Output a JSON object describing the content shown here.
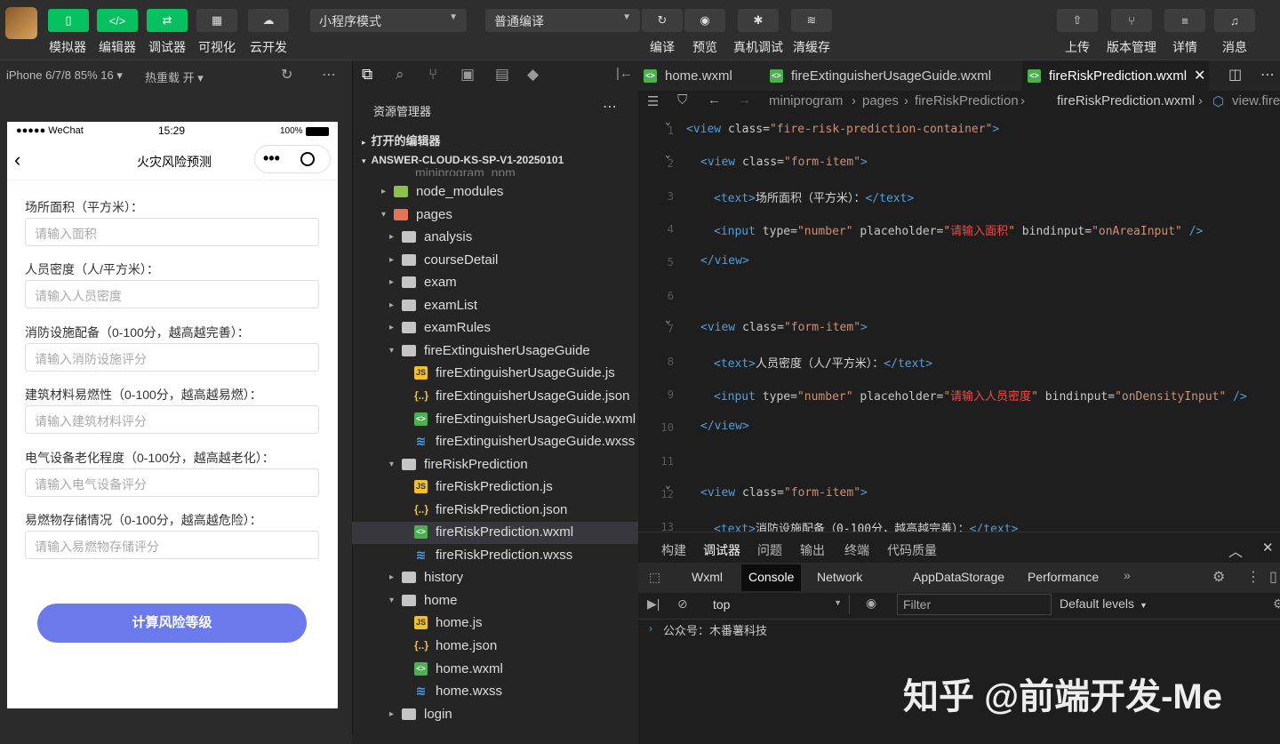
{
  "toolbar": {
    "left_buttons": [
      {
        "label": "模拟器",
        "icon": "phone-icon",
        "symbol": "▯",
        "green": true
      },
      {
        "label": "编辑器",
        "icon": "code-icon",
        "symbol": "</>",
        "green": true
      },
      {
        "label": "调试器",
        "icon": "debug-icon",
        "symbol": "⇄",
        "green": true
      },
      {
        "label": "可视化",
        "icon": "layout-icon",
        "symbol": "▦",
        "green": false
      },
      {
        "label": "云开发",
        "icon": "cloud-icon",
        "symbol": "☁",
        "green": false
      }
    ],
    "mode_select": "小程序模式",
    "compile_select": "普通编译",
    "mid_buttons": [
      {
        "label": "编译",
        "icon": "refresh-icon",
        "symbol": "↻"
      },
      {
        "label": "预览",
        "icon": "eye-icon",
        "symbol": "◉"
      },
      {
        "label": "真机调试",
        "icon": "bug-icon",
        "symbol": "✱"
      },
      {
        "label": "清缓存",
        "icon": "layers-icon",
        "symbol": "≋"
      }
    ],
    "right_buttons": [
      {
        "label": "上传",
        "icon": "upload-icon",
        "symbol": "⇧"
      },
      {
        "label": "版本管理",
        "icon": "branch-icon",
        "symbol": "⑂"
      },
      {
        "label": "详情",
        "icon": "menu-icon",
        "symbol": "≡"
      },
      {
        "label": "消息",
        "icon": "bell-icon",
        "symbol": "♫"
      }
    ]
  },
  "simulator": {
    "device": "iPhone 6/7/8 85% 16 ▾",
    "hot_reload": "热重载 开 ▾",
    "status_carrier": "●●●●● WeChat",
    "status_time": "15:29",
    "status_battery": "100%",
    "nav_title": "火灾风险预测",
    "fields": [
      {
        "label": "场所面积（平方米）：",
        "placeholder": "请输入面积"
      },
      {
        "label": "人员密度（人/平方米）：",
        "placeholder": "请输入人员密度"
      },
      {
        "label": "消防设施配备（0-100分，越高越完善）：",
        "placeholder": "请输入消防设施评分"
      },
      {
        "label": "建筑材料易燃性（0-100分，越高越易燃）：",
        "placeholder": "请输入建筑材料评分"
      },
      {
        "label": "电气设备老化程度（0-100分，越高越老化）：",
        "placeholder": "请输入电气设备评分"
      },
      {
        "label": "易燃物存储情况（0-100分，越高越危险）：",
        "placeholder": "请输入易燃物存储评分"
      }
    ],
    "submit_label": "计算风险等级"
  },
  "explorer": {
    "title": "资源管理器",
    "open_editors": "打开的编辑器",
    "project": "ANSWER-CLOUD-KS-SP-V1-20250101",
    "partial_top": "miniprogram_npm",
    "items": [
      {
        "label": "node_modules",
        "type": "folder-green",
        "depth": 1,
        "arrow": "▸"
      },
      {
        "label": "pages",
        "type": "folder-red",
        "depth": 1,
        "arrow": "▾"
      },
      {
        "label": "analysis",
        "type": "folder",
        "depth": 2,
        "arrow": "▸"
      },
      {
        "label": "courseDetail",
        "type": "folder",
        "depth": 2,
        "arrow": "▸"
      },
      {
        "label": "exam",
        "type": "folder",
        "depth": 2,
        "arrow": "▸"
      },
      {
        "label": "examList",
        "type": "folder",
        "depth": 2,
        "arrow": "▸"
      },
      {
        "label": "examRules",
        "type": "folder",
        "depth": 2,
        "arrow": "▸"
      },
      {
        "label": "fireExtinguisherUsageGuide",
        "type": "folder",
        "depth": 2,
        "arrow": "▾"
      },
      {
        "label": "fireExtinguisherUsageGuide.js",
        "type": "js",
        "depth": 3,
        "arrow": ""
      },
      {
        "label": "fireExtinguisherUsageGuide.json",
        "type": "json",
        "depth": 3,
        "arrow": ""
      },
      {
        "label": "fireExtinguisherUsageGuide.wxml",
        "type": "wxml",
        "depth": 3,
        "arrow": ""
      },
      {
        "label": "fireExtinguisherUsageGuide.wxss",
        "type": "wxss",
        "depth": 3,
        "arrow": ""
      },
      {
        "label": "fireRiskPrediction",
        "type": "folder",
        "depth": 2,
        "arrow": "▾"
      },
      {
        "label": "fireRiskPrediction.js",
        "type": "js",
        "depth": 3,
        "arrow": ""
      },
      {
        "label": "fireRiskPrediction.json",
        "type": "json",
        "depth": 3,
        "arrow": ""
      },
      {
        "label": "fireRiskPrediction.wxml",
        "type": "wxml",
        "depth": 3,
        "arrow": "",
        "selected": true
      },
      {
        "label": "fireRiskPrediction.wxss",
        "type": "wxss",
        "depth": 3,
        "arrow": ""
      },
      {
        "label": "history",
        "type": "folder",
        "depth": 2,
        "arrow": "▸"
      },
      {
        "label": "home",
        "type": "folder",
        "depth": 2,
        "arrow": "▾"
      },
      {
        "label": "home.js",
        "type": "js",
        "depth": 3,
        "arrow": ""
      },
      {
        "label": "home.json",
        "type": "json",
        "depth": 3,
        "arrow": ""
      },
      {
        "label": "home.wxml",
        "type": "wxml",
        "depth": 3,
        "arrow": ""
      },
      {
        "label": "home.wxss",
        "type": "wxss",
        "depth": 3,
        "arrow": ""
      },
      {
        "label": "login",
        "type": "folder",
        "depth": 2,
        "arrow": "▸"
      }
    ]
  },
  "editor": {
    "tabs": [
      {
        "label": "home.wxml",
        "active": false
      },
      {
        "label": "fireExtinguisherUsageGuide.wxml",
        "active": false
      },
      {
        "label": "fireRiskPrediction.wxml",
        "active": true
      }
    ],
    "breadcrumb": [
      "miniprogram",
      "pages",
      "fireRiskPrediction",
      "fireRiskPrediction.wxml",
      "view.fire"
    ],
    "line_numbers": [
      "1",
      "2",
      "3",
      "4",
      "5",
      "6",
      "7",
      "8",
      "9",
      "10",
      "11",
      "12",
      "13"
    ],
    "code": {
      "l1": {
        "tag": "<view",
        "attr": " class=",
        "val": "\"fire-risk-prediction-container\"",
        "end": ">"
      },
      "l2": {
        "tag": "<view",
        "attr": " class=",
        "val": "\"form-item\"",
        "end": ">"
      },
      "l3": {
        "open": "<text>",
        "text": "场所面积（平方米）：",
        "close": "</text>"
      },
      "l4": {
        "tag": "<input",
        "a1": " type=",
        "v1": "\"number\"",
        "a2": " placeholder=",
        "v2q1": "\"",
        "v2": "请输入面积",
        "v2q2": "\"",
        "a3": " bindinput=",
        "v3": "\"onAreaInput\"",
        "end": " />"
      },
      "l5": {
        "close": "</view>"
      },
      "l7": {
        "tag": "<view",
        "attr": " class=",
        "val": "\"form-item\"",
        "end": ">"
      },
      "l8": {
        "open": "<text>",
        "text": "人员密度（人/平方米）：",
        "close": "</text>"
      },
      "l9": {
        "tag": "<input",
        "a1": " type=",
        "v1": "\"number\"",
        "a2": " placeholder=",
        "v2q1": "\"",
        "v2": "请输入人员密度",
        "v2q2": "\"",
        "a3": " bindinput=",
        "v3": "\"onDensityInput\"",
        "end": " />"
      },
      "l10": {
        "close": "</view>"
      },
      "l12": {
        "tag": "<view",
        "attr": " class=",
        "val": "\"form-item\"",
        "end": ">"
      },
      "l13": {
        "open": "<text>",
        "text": "消防设施配备（0-100分，越高越完善）：",
        "close": "</text>"
      }
    }
  },
  "devtools": {
    "tabs": [
      "构建",
      "调试器",
      "问题",
      "输出",
      "终端",
      "代码质量"
    ],
    "panel_tabs": [
      "Wxml",
      "Console",
      "Network",
      "AppData",
      "Storage",
      "Performance"
    ],
    "more": "»",
    "context": "top",
    "filter_placeholder": "Filter",
    "levels": "Default levels",
    "console_line": "公众号：木番薯科技"
  },
  "watermark": "知乎 @前端开发-Me"
}
